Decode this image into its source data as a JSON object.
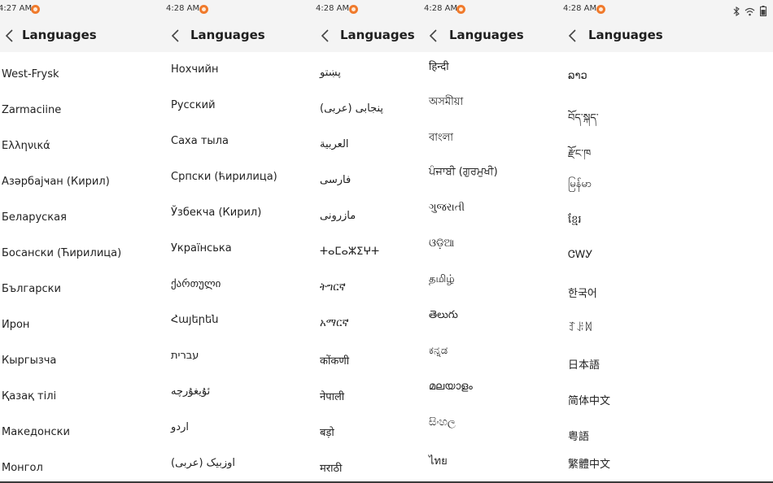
{
  "header_title": "Languages",
  "icons": {
    "back": "chevron-left-icon",
    "notification": "notification-dot-icon",
    "bluetooth": "bluetooth-icon",
    "wifi": "wifi-icon",
    "battery": "battery-icon"
  },
  "colors": {
    "notification": "#f07a2c",
    "bar": "#f4f4f4"
  },
  "panels": [
    {
      "time": "4:27 AM",
      "items": [
        "West-Frysk",
        "Zarmaciine",
        "Ελληνικά",
        "Азәрбајҹан (Кирил)",
        "Беларуская",
        "Босански (Ћирилица)",
        "Български",
        "Ирон",
        "Кыргызча",
        "Қазақ тілі",
        "Македонски",
        "Монгол"
      ]
    },
    {
      "time": "4:28 AM",
      "items": [
        "Нохчийн",
        "Русский",
        "Саха тыла",
        "Српски (ћирилица)",
        "Ўзбекча (Кирил)",
        "Українська",
        "ქართული",
        "Հայերեն",
        "עברית",
        "ئۇيغۇرچە",
        "اردو",
        "اوزبیک (عربی)"
      ]
    },
    {
      "time": "4:28 AM",
      "items": [
        "پښتو",
        "پنجابی (عربی)",
        "العربية",
        "فارسی",
        "مازرونی",
        "ⵜⴰⵎⴰⵣⵉⵖⵜ",
        "ትግርኛ",
        "አማርኛ",
        "कोंकणी",
        "नेपाली",
        "बड़ो",
        "मराठी"
      ]
    },
    {
      "time": "4:28 AM",
      "items": [
        "हिन्दी",
        "অসমীয়া",
        "বাংলা",
        "ਪੰਜਾਬੀ (ਗੁਰਮੁਖੀ)",
        "ગુજરાતી",
        "ଓଡ଼ିଆ",
        "தமிழ்",
        "తెలుగు",
        "ಕನ್ನಡ",
        "മലയാളം",
        "සිංහල",
        "ไทย"
      ]
    },
    {
      "time": "4:28 AM",
      "items": [
        "ລາວ",
        "བོད་སྐད་",
        "རྫོང་ཁ",
        "မြန်မာ",
        "ខ្មែរ",
        "ᏣᎳᎩ",
        "한국어",
        "ꆈꌠꉙ",
        "日本語",
        "简体中文",
        "粤語",
        "繁體中文"
      ]
    }
  ]
}
